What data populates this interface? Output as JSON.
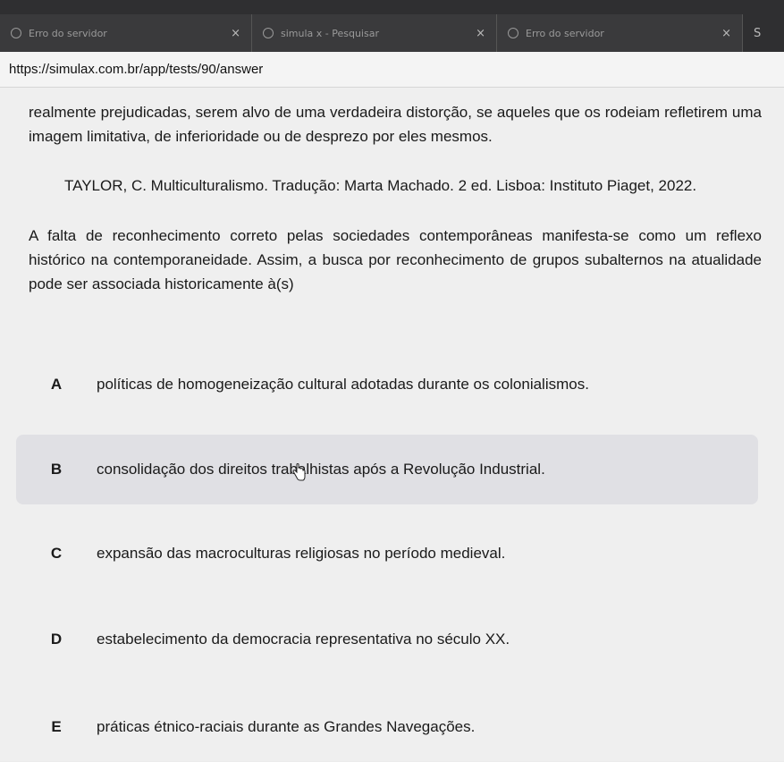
{
  "browser": {
    "tabs": [
      {
        "title": "Erro do servidor",
        "close": "×"
      },
      {
        "title": "simula x - Pesquisar",
        "close": "×"
      },
      {
        "title": "Erro do servidor",
        "close": "×"
      }
    ],
    "overflow_label": "S",
    "url": "https://simulax.com.br/app/tests/90/answer"
  },
  "question": {
    "excerpt": "realmente prejudicadas, serem alvo de uma verdadeira distorção, se aqueles que os rodeiam refletirem uma imagem limitativa, de inferioridade ou de desprezo por eles mesmos.",
    "reference": "TAYLOR, C. Multiculturalismo. Tradução: Marta Machado. 2 ed. Lisboa: Instituto Piaget, 2022.",
    "prompt": "A falta de reconhecimento correto pelas sociedades contemporâneas manifesta-se como um reflexo histórico na contemporaneidade. Assim, a busca por reconhecimento de grupos subalternos na atualidade pode ser associada historicamente à(s)",
    "options": [
      {
        "letter": "A",
        "text": "políticas de homogeneização cultural adotadas durante os colonialismos."
      },
      {
        "letter": "B",
        "text": "consolidação dos direitos trabalhistas após a Revolução Industrial."
      },
      {
        "letter": "C",
        "text": "expansão das macroculturas religiosas no período medieval."
      },
      {
        "letter": "D",
        "text": "estabelecimento da democracia representativa no século XX."
      },
      {
        "letter": "E",
        "text": "práticas étnico-raciais durante as Grandes Navegações."
      }
    ],
    "selected": "B"
  }
}
